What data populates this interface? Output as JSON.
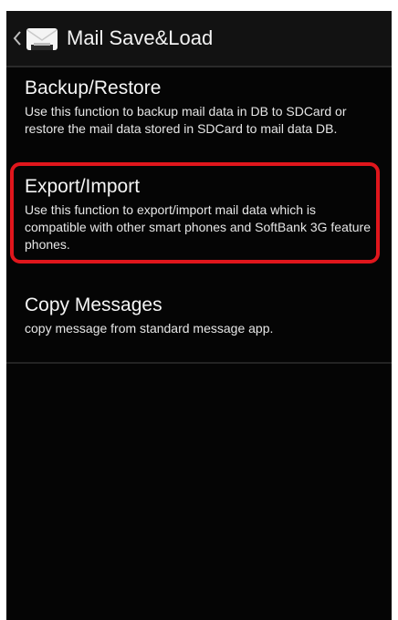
{
  "header": {
    "title": "Mail Save&Load",
    "back_icon": "chevron-left-icon",
    "app_icon": "mail-envelope-icon"
  },
  "items": [
    {
      "title": "Backup/Restore",
      "description": "Use this function to backup mail data in DB to SDCard or restore the mail data stored in SDCard to mail data DB."
    },
    {
      "title": "Export/Import",
      "description": "Use this function to export/import mail data which is compatible with other smart phones and SoftBank 3G feature phones.",
      "highlighted": true
    },
    {
      "title": "Copy Messages",
      "description": "copy message from standard message app."
    }
  ],
  "colors": {
    "background": "#050505",
    "action_bar": "#121212",
    "text": "#f5f5f5",
    "highlight": "#e0161c"
  }
}
